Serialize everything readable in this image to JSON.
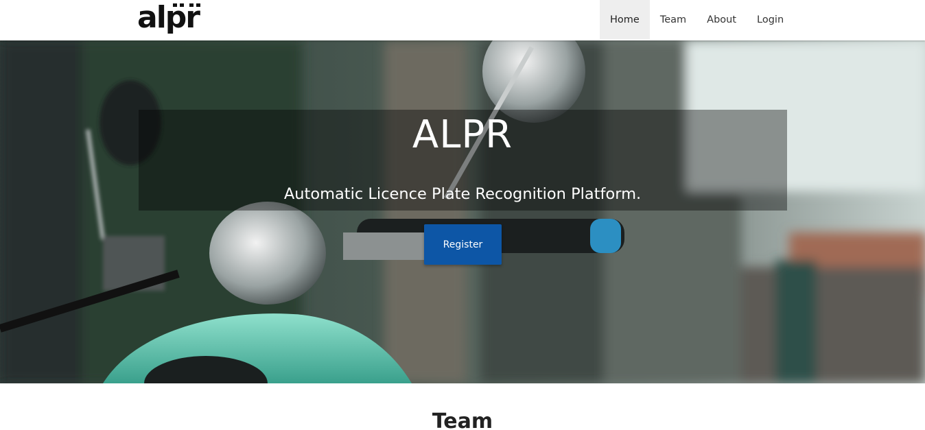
{
  "brand": {
    "logo_text": "alpr"
  },
  "nav": {
    "items": [
      {
        "label": "Home",
        "active": true
      },
      {
        "label": "Team",
        "active": false
      },
      {
        "label": "About",
        "active": false
      },
      {
        "label": "Login",
        "active": false
      }
    ]
  },
  "hero": {
    "title": "ALPR",
    "subtitle": "Automatic Licence Plate Recognition Platform.",
    "cta_label": "Register",
    "background_image": "scooter-photo"
  },
  "team_section": {
    "title": "Team"
  },
  "colors": {
    "primary_button": "#0d56a6",
    "nav_active_bg": "#eeeeee",
    "text_dark": "#222222"
  }
}
